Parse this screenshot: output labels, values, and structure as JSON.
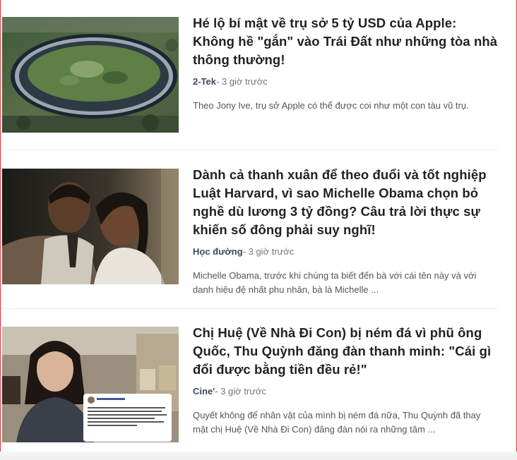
{
  "articles": [
    {
      "title": "Hé lộ bí mật về trụ sở 5 tỷ USD của Apple: Không hề \"gắn\" vào Trái Đất như những tòa nhà thông thường!",
      "category": "2-Tek",
      "time": "3 giờ trước",
      "excerpt": "Theo Jony Ive, trụ sở Apple có thể được coi như một con tàu vũ trụ."
    },
    {
      "title": "Dành cả thanh xuân để theo đuổi và tốt nghiệp Luật Harvard, vì sao Michelle Obama chọn bỏ nghề dù lương 3 tỷ đồng? Câu trả lời thực sự khiến số đông phải suy nghĩ!",
      "category": "Học đường",
      "time": "3 giờ trước",
      "excerpt": "Michelle Obama, trước khi chúng ta biết đến bà với cái tên này và với danh hiệu đệ nhất phu nhân, bà là Michelle ..."
    },
    {
      "title": "Chị Huệ (Về Nhà Đi Con) bị ném đá vì phũ ông Quốc, Thu Quỳnh đăng đàn thanh minh: \"Cái gì đổi được bằng tiền đều rẻ!\"",
      "category": "Cine'",
      "time": "3 giờ trước",
      "excerpt": "Quyết không để nhân vật của mình bị ném đá nữa, Thu Quỳnh đã thay mặt chị Huệ (Về Nhà Đi Con) đăng đàn nói ra những tâm ..."
    }
  ],
  "meta_separator": "- "
}
